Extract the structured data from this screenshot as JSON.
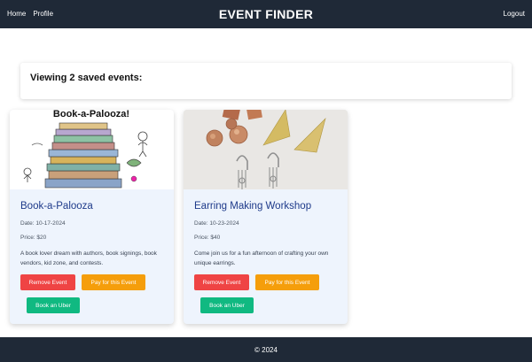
{
  "header": {
    "nav": {
      "home": "Home",
      "profile": "Profile"
    },
    "title": "EVENT FINDER",
    "logout": "Logout"
  },
  "summary": {
    "text": "Viewing 2 saved events:"
  },
  "events": [
    {
      "image_text": "Book-a-Palooza!",
      "title": "Book-a-Palooza",
      "date": "Date: 10-17-2024",
      "price": "Price: $20",
      "description": "A book lover dream with authors, book signings, book vendors, kid zone, and contests.",
      "remove_label": "Remove Event",
      "pay_label": "Pay for this Event",
      "uber_label": "Book an Uber"
    },
    {
      "title": "Earring Making Workshop",
      "date": "Date: 10-23-2024",
      "price": "Price: $40",
      "description": "Come join us for a fun afternoon of crafting your own unique earrings.",
      "remove_label": "Remove Event",
      "pay_label": "Pay for this Event",
      "uber_label": "Book an Uber"
    }
  ],
  "colors": {
    "navbar": "#1f2937",
    "card_bg": "#eef4fd",
    "title_blue": "#1e3a8a",
    "remove": "#ef4444",
    "pay": "#f59e0b",
    "uber": "#10b981"
  },
  "footer": {
    "text": "© 2024"
  }
}
